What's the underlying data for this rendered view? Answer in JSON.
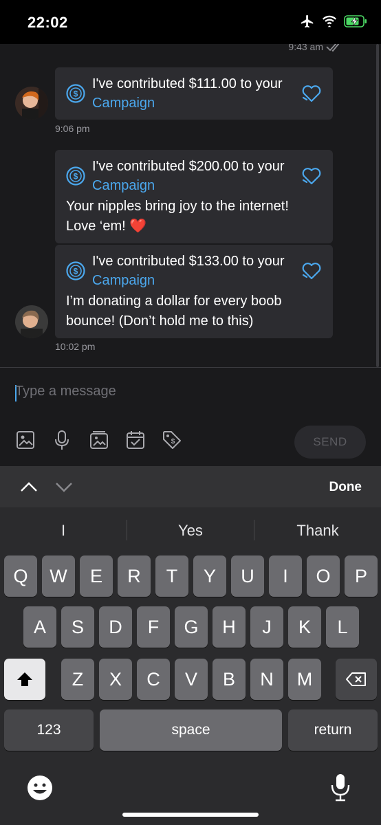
{
  "status": {
    "time": "22:02"
  },
  "chat": {
    "read_time": "9:43 am",
    "messages": [
      {
        "title_prefix": "I've contributed $111.00 to your ",
        "title_link": "Campaign",
        "body": "",
        "time": "9:06 pm"
      },
      {
        "title_prefix": "I've contributed $200.00 to your ",
        "title_link": "Campaign",
        "body": "Your nipples bring joy to the internet! Love ‘em! ❤️",
        "time": ""
      },
      {
        "title_prefix": "I've contributed $133.00 to your ",
        "title_link": "Campaign",
        "body": "I’m donating a dollar for every boob bounce! (Don’t hold me to this)",
        "time": "10:02 pm"
      }
    ]
  },
  "compose": {
    "placeholder": "Type a message",
    "send_label": "SEND"
  },
  "keyboard": {
    "done_label": "Done",
    "suggestions": [
      "I",
      "Yes",
      "Thank"
    ],
    "row1": [
      "Q",
      "W",
      "E",
      "R",
      "T",
      "Y",
      "U",
      "I",
      "O",
      "P"
    ],
    "row2": [
      "A",
      "S",
      "D",
      "F",
      "G",
      "H",
      "J",
      "K",
      "L"
    ],
    "row3": [
      "Z",
      "X",
      "C",
      "V",
      "B",
      "N",
      "M"
    ],
    "numbers_label": "123",
    "space_label": "space",
    "return_label": "return"
  },
  "icons": {
    "airplane": "airplane-icon",
    "wifi": "wifi-icon",
    "battery": "battery-charging-icon",
    "coin": "dollar-coin-icon",
    "heart": "heart-icon",
    "image": "image-icon",
    "mic": "microphone-icon",
    "gallery": "gallery-icon",
    "calendar": "calendar-check-icon",
    "tag": "price-tag-icon",
    "emoji": "emoji-icon",
    "dictation": "dictation-icon",
    "shift": "shift-icon",
    "backspace": "backspace-icon"
  },
  "colors": {
    "accent": "#4ba8ee",
    "bubble": "#2c2c30",
    "background": "#1a1a1c",
    "battery": "#4cd964"
  }
}
